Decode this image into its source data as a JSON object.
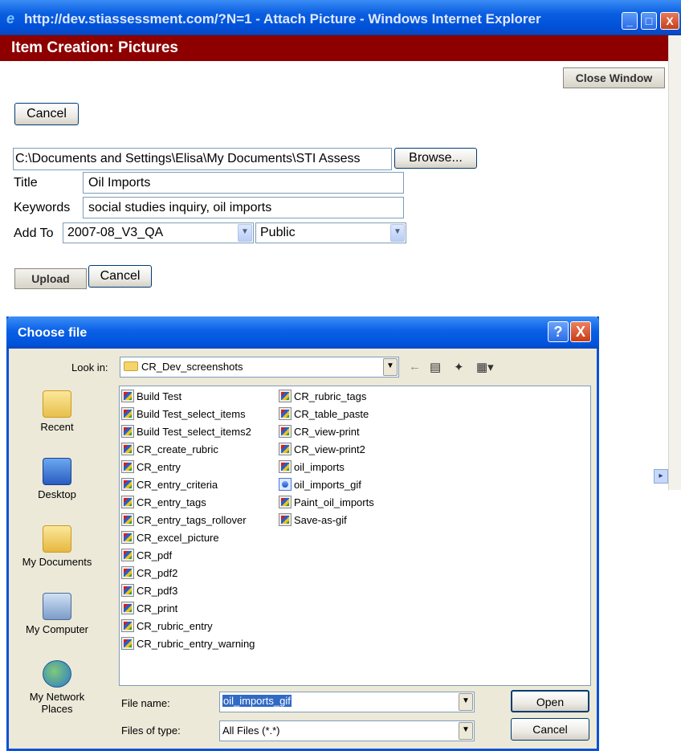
{
  "browser": {
    "title": "http://dev.stiassessment.com/?N=1 - Attach Picture - Windows Internet Explorer"
  },
  "page": {
    "heading": "Item Creation: Pictures",
    "close_window": "Close Window",
    "cancel_top": "Cancel",
    "file_path": "C:\\Documents and Settings\\Elisa\\My Documents\\STI Assess",
    "browse": "Browse...",
    "title_label": "Title",
    "title_value": "Oil Imports",
    "keywords_label": "Keywords",
    "keywords_value": "social studies inquiry, oil imports",
    "addto_label": "Add To",
    "addto_value": "2007-08_V3_QA",
    "visibility_value": "Public",
    "upload": "Upload",
    "cancel_bottom": "Cancel"
  },
  "dialog": {
    "title": "Choose file",
    "look_in_label": "Look in:",
    "look_in_value": "CR_Dev_screenshots",
    "places": [
      "Recent",
      "Desktop",
      "My Documents",
      "My Computer",
      "My Network Places"
    ],
    "files_col1": [
      "Build Test",
      "Build Test_select_items",
      "Build Test_select_items2",
      "CR_create_rubric",
      "CR_entry",
      "CR_entry_criteria",
      "CR_entry_tags",
      "CR_entry_tags_rollover",
      "CR_excel_picture",
      "CR_pdf",
      "CR_pdf2",
      "CR_pdf3",
      "CR_print",
      "CR_rubric_entry",
      "CR_rubric_entry_warning"
    ],
    "files_col2": [
      "CR_rubric_tags",
      "CR_table_paste",
      "CR_view-print",
      "CR_view-print2",
      "oil_imports",
      "oil_imports_gif",
      "Paint_oil_imports",
      "Save-as-gif"
    ],
    "file_name_label": "File name:",
    "file_name_value": "oil_imports_gif",
    "files_of_type_label": "Files of type:",
    "files_of_type_value": "All Files (*.*)",
    "open": "Open",
    "cancel": "Cancel"
  }
}
